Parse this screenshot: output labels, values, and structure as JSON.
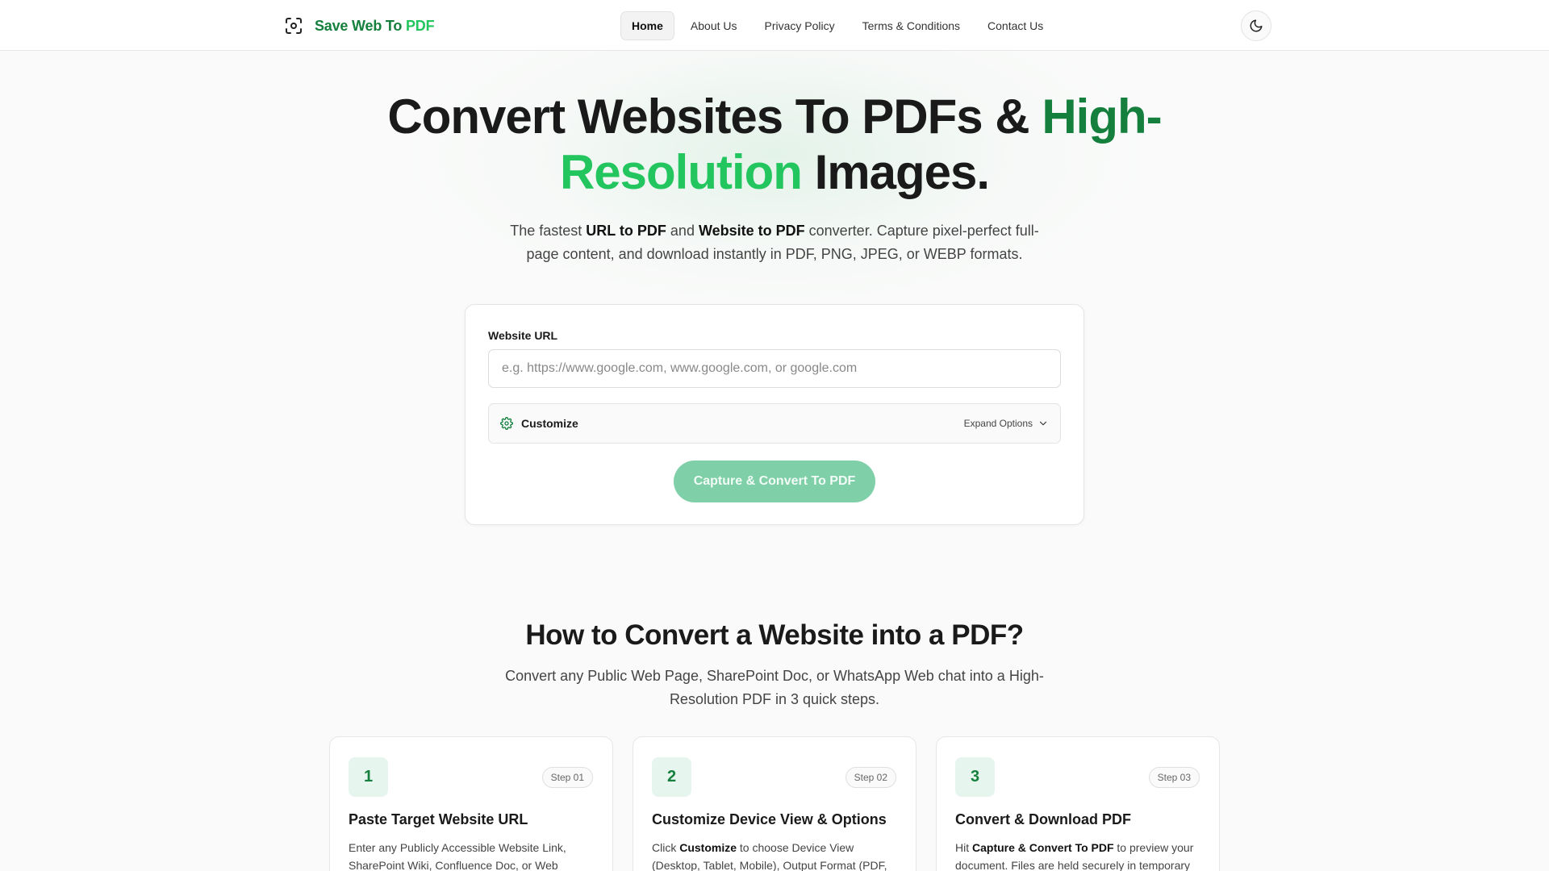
{
  "brand": {
    "name_main": "Save Web To ",
    "name_accent": "PDF",
    "logo_icon": "screenshot-frame-icon"
  },
  "nav": {
    "items": [
      {
        "label": "Home",
        "active": true
      },
      {
        "label": "About Us"
      },
      {
        "label": "Privacy Policy"
      },
      {
        "label": "Terms & Conditions"
      },
      {
        "label": "Contact Us"
      }
    ],
    "theme_icon": "moon-icon"
  },
  "hero": {
    "title_part1": "Convert Websites To PDFs & ",
    "title_accent1": "High-",
    "title_accent2": "Resolution",
    "title_part2": " Images.",
    "sub_1": "The fastest ",
    "sub_b1": "URL to PDF",
    "sub_2": " and ",
    "sub_b2": "Website to PDF",
    "sub_3": " converter. Capture pixel-perfect full-page content, and download instantly in PDF, PNG, JPEG, or WEBP formats."
  },
  "form": {
    "url_label": "Website URL",
    "url_value": "",
    "url_placeholder": "e.g. https://www.google.com, www.google.com, or google.com",
    "customize_label": "Customize",
    "customize_icon": "gear-icon",
    "expand_label": "Expand Options",
    "submit_label": "Capture & Convert To PDF"
  },
  "how_to": {
    "title": "How to Convert a Website into a PDF?",
    "subtitle": "Convert any Public Web Page, SharePoint Doc, or WhatsApp Web chat into a High-Resolution PDF in 3 quick steps.",
    "steps": [
      {
        "number": "1",
        "badge": "Step 01",
        "title": "Paste Target Website URL",
        "desc": "Enter any Publicly Accessible Website Link, SharePoint Wiki, Confluence Doc, or Web"
      },
      {
        "number": "2",
        "badge": "Step 02",
        "title": "Customize Device View & Options",
        "desc_1": "Click ",
        "desc_b": "Customize",
        "desc_2": " to choose Device View (Desktop, Tablet, Mobile), Output Format (PDF,"
      },
      {
        "number": "3",
        "badge": "Step 03",
        "title": "Convert & Download PDF",
        "desc_1": "Hit ",
        "desc_b": "Capture & Convert To PDF",
        "desc_2": " to preview your document. Files are held securely in temporary"
      }
    ]
  },
  "colors": {
    "brand_dark": "#15803d",
    "brand_light": "#22c55e",
    "button_bg": "#7fcfa8"
  }
}
